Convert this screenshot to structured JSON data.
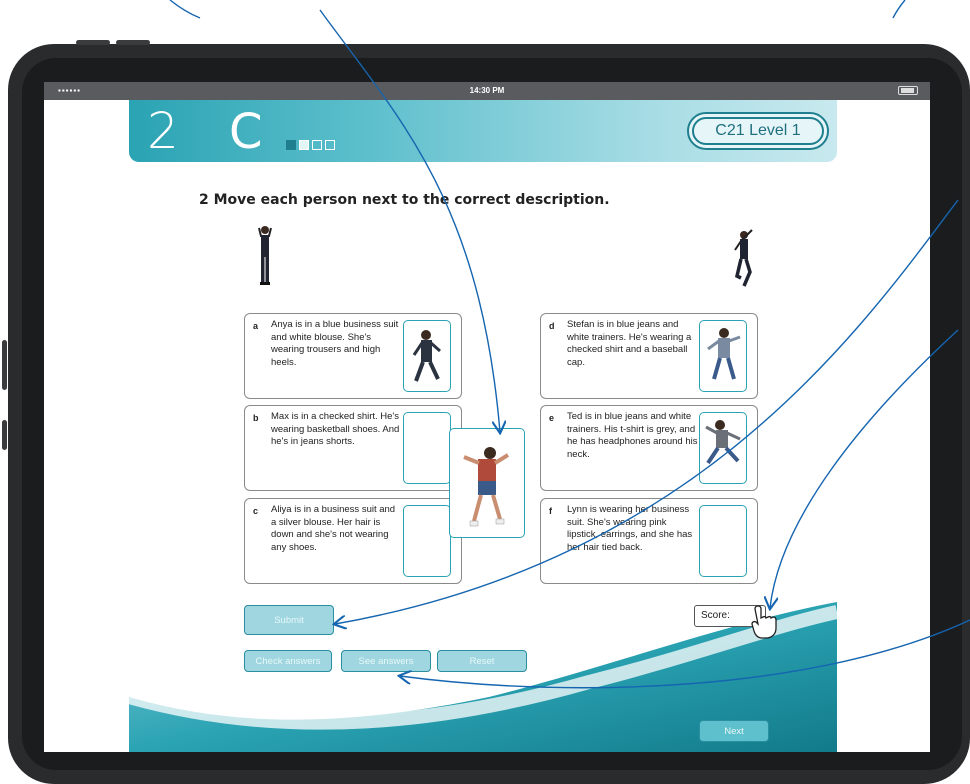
{
  "status_bar": {
    "signal": "▪▪▪▪▪▪",
    "time": "14:30 PM"
  },
  "header": {
    "unit_number": "2",
    "lesson_letter": "C",
    "progress_steps": [
      true,
      false,
      false,
      false
    ],
    "level": "C21  Level 1"
  },
  "instruction": "2  Move each person next to the correct description.",
  "cards": [
    {
      "letter": "a",
      "text": "Anya is in a blue business suit and white blouse. She's wearing trousers and high heels.",
      "filled": true
    },
    {
      "letter": "b",
      "text": "Max is in a checked shirt. He's wearing basketball shoes. And he's in jeans shorts.",
      "filled": false
    },
    {
      "letter": "c",
      "text": "Aliya is in a business suit and a silver blouse. Her hair is down and she's not wearing any shoes.",
      "filled": false
    },
    {
      "letter": "d",
      "text": "Stefan is in blue jeans and white trainers. He's wearing a checked shirt and a baseball cap.",
      "filled": true
    },
    {
      "letter": "e",
      "text": "Ted is in blue jeans and white trainers. His t-shirt is grey, and he has headphones around his neck.",
      "filled": true
    },
    {
      "letter": "f",
      "text": "Lynn is wearing her business suit. She's wearing pink lipstick, earrings, and she has her hair tied back.",
      "filled": false
    }
  ],
  "score": {
    "label": "Score:"
  },
  "buttons": {
    "submit": "Submit",
    "check": "Check answers",
    "see": "See answers",
    "reset": "Reset",
    "next": "Next"
  },
  "colors": {
    "accent": "#2aa3b3",
    "dark_accent": "#1f7f8f",
    "annotation": "#1565b0",
    "button_fill": "#9fd6df"
  }
}
